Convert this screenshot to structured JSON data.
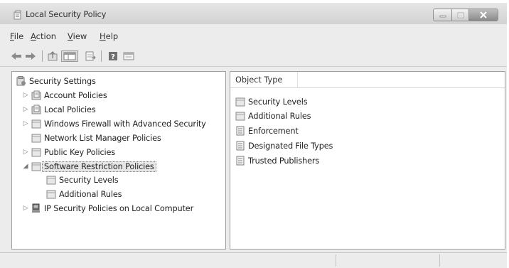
{
  "window": {
    "title": "Local Security Policy"
  },
  "menu": [
    {
      "label": "File",
      "key": "F",
      "rest": "ile"
    },
    {
      "label": "Action",
      "key": "A",
      "rest": "ction"
    },
    {
      "label": "View",
      "key": "V",
      "rest": "iew"
    },
    {
      "label": "Help",
      "key": "H",
      "rest": "elp"
    }
  ],
  "toolbar": {
    "buttons": [
      "back-icon",
      "forward-icon",
      "up-folder-icon",
      "show-hide-tree-icon",
      "export-list-icon",
      "help-icon",
      "properties-icon"
    ]
  },
  "tree": {
    "root": {
      "label": "Security Settings",
      "icon": "security-settings-icon"
    },
    "items": [
      {
        "label": "Account Policies",
        "expander": "▷",
        "icon": "folder-policy-icon"
      },
      {
        "label": "Local Policies",
        "expander": "▷",
        "icon": "folder-policy-icon"
      },
      {
        "label": "Windows Firewall with Advanced Security",
        "expander": "▷",
        "icon": "folder-icon"
      },
      {
        "label": "Network List Manager Policies",
        "expander": "",
        "icon": "folder-icon"
      },
      {
        "label": "Public Key Policies",
        "expander": "▷",
        "icon": "folder-icon"
      },
      {
        "label": "Software Restriction Policies",
        "expander": "◢",
        "icon": "folder-icon",
        "selected": true
      },
      {
        "label": "Security Levels",
        "expander": "",
        "icon": "folder-icon"
      },
      {
        "label": "Additional Rules",
        "expander": "",
        "icon": "folder-icon"
      },
      {
        "label": "IP Security Policies on Local Computer",
        "expander": "▷",
        "icon": "ip-security-icon"
      }
    ]
  },
  "list": {
    "column_header": "Object Type",
    "rows": [
      {
        "label": "Security Levels",
        "icon": "folder-icon"
      },
      {
        "label": "Additional Rules",
        "icon": "folder-icon"
      },
      {
        "label": "Enforcement",
        "icon": "policy-setting-icon"
      },
      {
        "label": "Designated File Types",
        "icon": "policy-setting-icon"
      },
      {
        "label": "Trusted Publishers",
        "icon": "policy-setting-icon"
      }
    ]
  }
}
